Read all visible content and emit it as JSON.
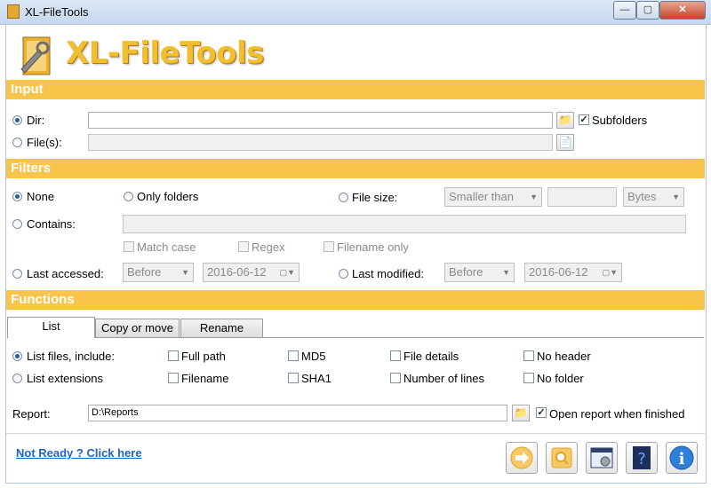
{
  "window": {
    "title": "XL-FileTools"
  },
  "logo": {
    "text": "XL-FileTools"
  },
  "sections": {
    "input": "Input",
    "filters": "Filters",
    "functions": "Functions"
  },
  "input": {
    "dir_label": "Dir:",
    "files_label": "File(s):",
    "dir_value": "",
    "files_value": "",
    "subfolders_label": "Subfolders"
  },
  "filters": {
    "none": "None",
    "only_folders": "Only folders",
    "file_size": "File size:",
    "size_compare": "Smaller than",
    "size_value": "",
    "size_unit": "Bytes",
    "contains": "Contains:",
    "contains_value": "",
    "match_case": "Match case",
    "regex": "Regex",
    "filename_only": "Filename only",
    "last_accessed": "Last accessed:",
    "accessed_mode": "Before",
    "accessed_date": "2016-06-12",
    "last_modified": "Last modified:",
    "modified_mode": "Before",
    "modified_date": "2016-06-12"
  },
  "tabs": [
    "List",
    "Copy or move",
    "Rename"
  ],
  "list": {
    "list_files": "List files, include:",
    "list_extensions": "List extensions",
    "full_path": "Full path",
    "filename": "Filename",
    "md5": "MD5",
    "sha1": "SHA1",
    "file_details": "File details",
    "number_of_lines": "Number of lines",
    "no_header": "No header",
    "no_folder": "No folder"
  },
  "report": {
    "label": "Report:",
    "value": "D:\\Reports",
    "open_when_finished": "Open report when finished"
  },
  "footer": {
    "link": "Not Ready ? Click here"
  },
  "colors": {
    "section": "#f8c44a",
    "logo": "#f3bd30",
    "link": "#1e64c8"
  }
}
